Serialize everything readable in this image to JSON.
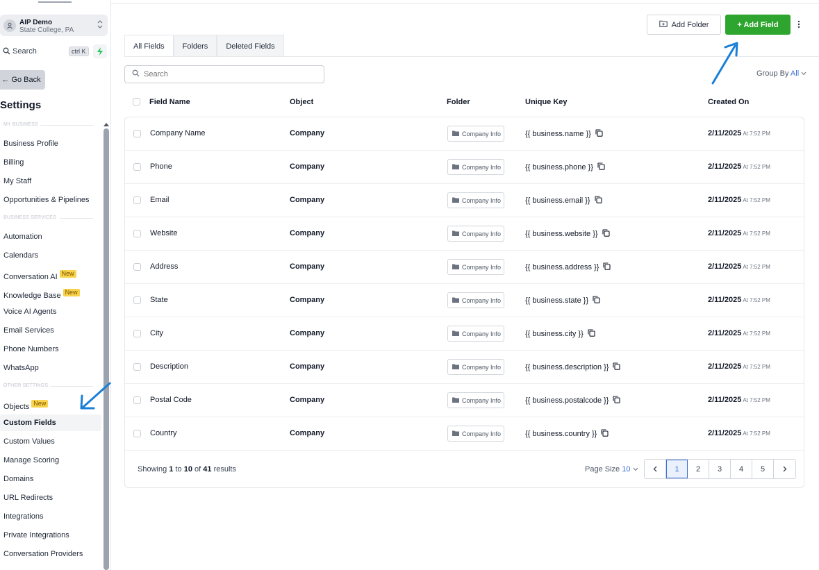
{
  "sidebar": {
    "account": {
      "name": "AIP Demo",
      "location": "State College, PA"
    },
    "search_label": "Search",
    "search_shortcut": "ctrl K",
    "go_back": "← Go Back",
    "title": "Settings",
    "sections": {
      "my_business": "MY BUSINESS",
      "business_services": "BUSINESS SERVICES",
      "other_settings": "OTHER SETTINGS"
    },
    "items": [
      {
        "label": "Business Profile"
      },
      {
        "label": "Billing"
      },
      {
        "label": "My Staff"
      },
      {
        "label": "Opportunities & Pipelines"
      },
      {
        "label": "Automation"
      },
      {
        "label": "Calendars"
      },
      {
        "label": "Conversation AI",
        "badge": "New"
      },
      {
        "label": "Knowledge Base",
        "badge": "New"
      },
      {
        "label": "Voice AI Agents"
      },
      {
        "label": "Email Services"
      },
      {
        "label": "Phone Numbers"
      },
      {
        "label": "WhatsApp"
      },
      {
        "label": "Objects",
        "badge": "New"
      },
      {
        "label": "Custom Fields",
        "active": true
      },
      {
        "label": "Custom Values"
      },
      {
        "label": "Manage Scoring"
      },
      {
        "label": "Domains"
      },
      {
        "label": "URL Redirects"
      },
      {
        "label": "Integrations"
      },
      {
        "label": "Private Integrations"
      },
      {
        "label": "Conversation Providers"
      }
    ]
  },
  "header": {
    "add_folder": "Add Folder",
    "add_field": "+ Add Field"
  },
  "tabs": [
    {
      "label": "All Fields",
      "active": true
    },
    {
      "label": "Folders"
    },
    {
      "label": "Deleted Fields"
    }
  ],
  "search": {
    "placeholder": "Search"
  },
  "group_by": {
    "label": "Group By",
    "value": "All"
  },
  "table": {
    "columns": [
      "Field Name",
      "Object",
      "Folder",
      "Unique Key",
      "Created On"
    ],
    "rows": [
      {
        "name": "Company Name",
        "object": "Company",
        "folder": "Company Info",
        "key": "{{ business.name }}",
        "date": "2/11/2025",
        "time": "At 7:52 PM"
      },
      {
        "name": "Phone",
        "object": "Company",
        "folder": "Company Info",
        "key": "{{ business.phone }}",
        "date": "2/11/2025",
        "time": "At 7:52 PM"
      },
      {
        "name": "Email",
        "object": "Company",
        "folder": "Company Info",
        "key": "{{ business.email }}",
        "date": "2/11/2025",
        "time": "At 7:52 PM"
      },
      {
        "name": "Website",
        "object": "Company",
        "folder": "Company Info",
        "key": "{{ business.website }}",
        "date": "2/11/2025",
        "time": "At 7:52 PM"
      },
      {
        "name": "Address",
        "object": "Company",
        "folder": "Company Info",
        "key": "{{ business.address }}",
        "date": "2/11/2025",
        "time": "At 7:52 PM"
      },
      {
        "name": "State",
        "object": "Company",
        "folder": "Company Info",
        "key": "{{ business.state }}",
        "date": "2/11/2025",
        "time": "At 7:52 PM"
      },
      {
        "name": "City",
        "object": "Company",
        "folder": "Company Info",
        "key": "{{ business.city }}",
        "date": "2/11/2025",
        "time": "At 7:52 PM"
      },
      {
        "name": "Description",
        "object": "Company",
        "folder": "Company Info",
        "key": "{{ business.description }}",
        "date": "2/11/2025",
        "time": "At 7:52 PM"
      },
      {
        "name": "Postal Code",
        "object": "Company",
        "folder": "Company Info",
        "key": "{{ business.postalcode }}",
        "date": "2/11/2025",
        "time": "At 7:52 PM"
      },
      {
        "name": "Country",
        "object": "Company",
        "folder": "Company Info",
        "key": "{{ business.country }}",
        "date": "2/11/2025",
        "time": "At 7:52 PM"
      }
    ]
  },
  "footer": {
    "showing_prefix": "Showing",
    "from": "1",
    "to_word": "to",
    "to": "10",
    "of_word": "of",
    "total": "41",
    "results_word": "results",
    "page_size_label": "Page Size",
    "page_size_value": "10",
    "pages": [
      "1",
      "2",
      "3",
      "4",
      "5"
    ],
    "current_page": "1"
  },
  "colors": {
    "accent": "#2ea52e",
    "link": "#3b6fd8",
    "annotation_arrow": "#1a7fd6",
    "badge": "#f8d24a"
  },
  "icons": {
    "account": "user-icon",
    "search": "search-icon",
    "bolt": "bolt-icon",
    "folder": "folder-icon",
    "copy": "copy-icon",
    "kebab": "kebab-icon"
  }
}
